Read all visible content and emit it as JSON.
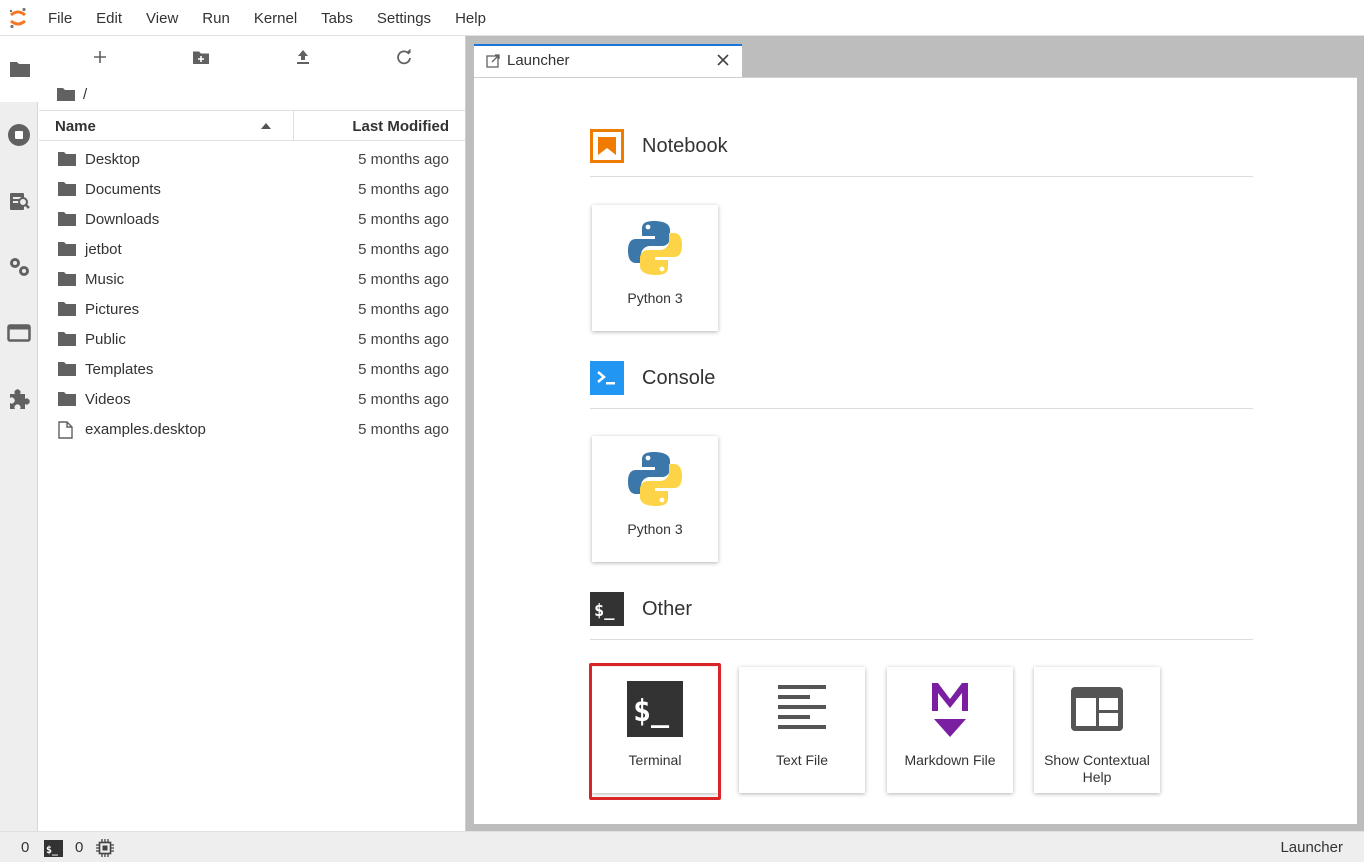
{
  "menubar": {
    "items": [
      "File",
      "Edit",
      "View",
      "Run",
      "Kernel",
      "Tabs",
      "Settings",
      "Help"
    ]
  },
  "filebrowser": {
    "breadcrumb": "/",
    "columns": {
      "name": "Name",
      "modified": "Last Modified"
    },
    "files": [
      {
        "name": "Desktop",
        "modified": "5 months ago",
        "type": "folder"
      },
      {
        "name": "Documents",
        "modified": "5 months ago",
        "type": "folder"
      },
      {
        "name": "Downloads",
        "modified": "5 months ago",
        "type": "folder"
      },
      {
        "name": "jetbot",
        "modified": "5 months ago",
        "type": "folder"
      },
      {
        "name": "Music",
        "modified": "5 months ago",
        "type": "folder"
      },
      {
        "name": "Pictures",
        "modified": "5 months ago",
        "type": "folder"
      },
      {
        "name": "Public",
        "modified": "5 months ago",
        "type": "folder"
      },
      {
        "name": "Templates",
        "modified": "5 months ago",
        "type": "folder"
      },
      {
        "name": "Videos",
        "modified": "5 months ago",
        "type": "folder"
      },
      {
        "name": "examples.desktop",
        "modified": "5 months ago",
        "type": "file"
      }
    ]
  },
  "tab": {
    "label": "Launcher"
  },
  "launcher": {
    "notebook": {
      "title": "Notebook",
      "cards": [
        {
          "label": "Python 3"
        }
      ]
    },
    "console": {
      "title": "Console",
      "cards": [
        {
          "label": "Python 3"
        }
      ]
    },
    "other": {
      "title": "Other",
      "cards": [
        {
          "label": "Terminal"
        },
        {
          "label": "Text File"
        },
        {
          "label": "Markdown File"
        },
        {
          "label": "Show Contextual Help"
        }
      ]
    }
  },
  "statusbar": {
    "kernels_count": "0",
    "terminals_count": "0",
    "active_label": "Launcher"
  },
  "colors": {
    "accent": "#1976d2",
    "notebook_orange": "#ef7c00",
    "console_blue": "#2196f3",
    "terminal_dark": "#333333",
    "markdown_purple": "#7b1fa2",
    "highlight_red": "#d92525"
  }
}
